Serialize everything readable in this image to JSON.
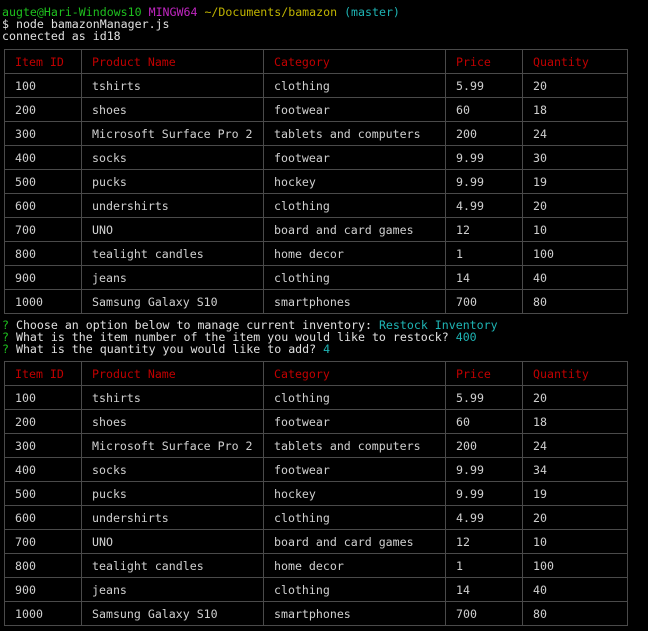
{
  "prompt": {
    "user_host": "augte@Hari-Windows10",
    "env": "MINGW64",
    "path": "~/Documents/bamazon",
    "branch": "(master)"
  },
  "command": "$ node bamazonManager.js",
  "connected": "connected as id18",
  "headers": [
    "Item ID",
    "Product Name",
    "Category",
    "Price",
    "Quantity"
  ],
  "table1": [
    [
      "100",
      "tshirts",
      "clothing",
      "5.99",
      "20"
    ],
    [
      "200",
      "shoes",
      "footwear",
      "60",
      "18"
    ],
    [
      "300",
      "Microsoft Surface Pro 2",
      "tablets and computers",
      "200",
      "24"
    ],
    [
      "400",
      "socks",
      "footwear",
      "9.99",
      "30"
    ],
    [
      "500",
      "pucks",
      "hockey",
      "9.99",
      "19"
    ],
    [
      "600",
      "undershirts",
      "clothing",
      "4.99",
      "20"
    ],
    [
      "700",
      "UNO",
      "board and card games",
      "12",
      "10"
    ],
    [
      "800",
      "tealight candles",
      "home decor",
      "1",
      "100"
    ],
    [
      "900",
      "jeans",
      "clothing",
      "14",
      "40"
    ],
    [
      "1000",
      "Samsung Galaxy S10",
      "smartphones",
      "700",
      "80"
    ]
  ],
  "questions": [
    {
      "mark": "?",
      "text": "Choose an option below to manage current inventory:",
      "answer": "Restock Inventory"
    },
    {
      "mark": "?",
      "text": "What is the item number of the item you would like to restock?",
      "answer": "400"
    },
    {
      "mark": "?",
      "text": "What is the quantity you would like to add?",
      "answer": "4"
    }
  ],
  "table2": [
    [
      "100",
      "tshirts",
      "clothing",
      "5.99",
      "20"
    ],
    [
      "200",
      "shoes",
      "footwear",
      "60",
      "18"
    ],
    [
      "300",
      "Microsoft Surface Pro 2",
      "tablets and computers",
      "200",
      "24"
    ],
    [
      "400",
      "socks",
      "footwear",
      "9.99",
      "34"
    ],
    [
      "500",
      "pucks",
      "hockey",
      "9.99",
      "19"
    ],
    [
      "600",
      "undershirts",
      "clothing",
      "4.99",
      "20"
    ],
    [
      "700",
      "UNO",
      "board and card games",
      "12",
      "10"
    ],
    [
      "800",
      "tealight candles",
      "home decor",
      "1",
      "100"
    ],
    [
      "900",
      "jeans",
      "clothing",
      "14",
      "40"
    ],
    [
      "1000",
      "Samsung Galaxy S10",
      "smartphones",
      "700",
      "80"
    ]
  ]
}
